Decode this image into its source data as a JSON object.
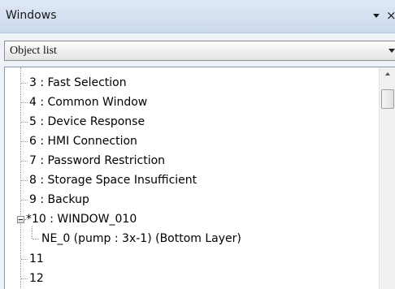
{
  "window": {
    "title": "Windows",
    "pin_icon": "dropdown-triangle-icon",
    "close_glyph": "×"
  },
  "selector": {
    "selected": "Object list"
  },
  "tree": {
    "items": [
      {
        "label": "3 : Fast Selection"
      },
      {
        "label": "4 : Common Window"
      },
      {
        "label": "5 : Device Response"
      },
      {
        "label": "6 : HMI Connection"
      },
      {
        "label": "7 : Password Restriction"
      },
      {
        "label": "8 : Storage Space Insufficient"
      },
      {
        "label": "9 : Backup"
      },
      {
        "label": "*10 : WINDOW_010",
        "expanded": true
      },
      {
        "label": "NE_0 (pump : 3x-1) (Bottom Layer)",
        "child": true
      },
      {
        "label": "11"
      },
      {
        "label": "12"
      }
    ]
  },
  "colors": {
    "titlebar": "#ccd9ec",
    "panel": "#eef3fa",
    "tree_bg": "#ffffff"
  }
}
